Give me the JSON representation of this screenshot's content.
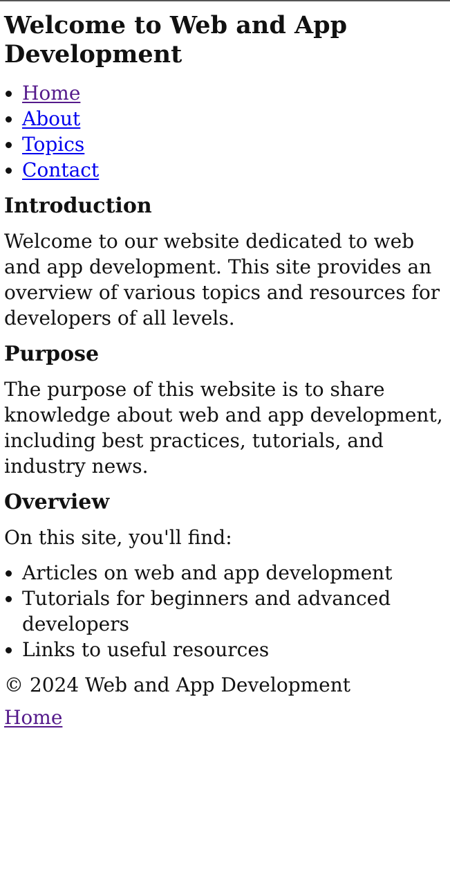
{
  "header": {
    "title": "Welcome to Web and App Development"
  },
  "nav": {
    "items": [
      {
        "label": "Home"
      },
      {
        "label": "About"
      },
      {
        "label": "Topics"
      },
      {
        "label": "Contact"
      }
    ]
  },
  "introduction": {
    "heading": "Introduction",
    "text": "Welcome to our website dedicated to web and app development. This site provides an overview of various topics and resources for developers of all levels."
  },
  "purpose": {
    "heading": "Purpose",
    "text": "The purpose of this website is to share knowledge about web and app development, including best practices, tutorials, and industry news."
  },
  "overview": {
    "heading": "Overview",
    "intro": "On this site, you'll find:",
    "items": [
      "Articles on web and app development",
      "Tutorials for beginners and advanced developers",
      "Links to useful resources"
    ]
  },
  "footer": {
    "copyright": "© 2024 Web and App Development",
    "link_label": "Home"
  },
  "colors": {
    "link_visited": "#551a8b",
    "link_unvisited": "#0000ee",
    "text": "#111111"
  }
}
